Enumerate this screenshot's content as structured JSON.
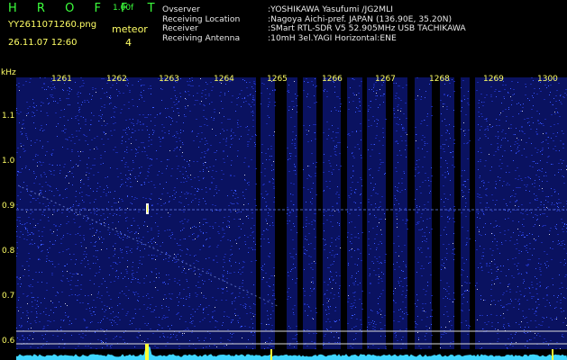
{
  "header": {
    "app_name": "H R O F F T",
    "version": "1.00f",
    "filename": "YY2611071260.png",
    "timestamp": "26.11.07 12:60",
    "meteor_label": "meteor",
    "meteor_count": "4",
    "info": [
      {
        "key": "Ovserver",
        "value": ":YOSHIKAWA Yasufumi /JG2MLI"
      },
      {
        "key": "Receiving Location",
        "value": ":Nagoya Aichi-pref. JAPAN (136.90E, 35.20N)"
      },
      {
        "key": "Receiver",
        "value": ":SMart RTL-SDR V5 52.905MHz USB TACHIKAWA"
      },
      {
        "key": "Receiving Antenna",
        "value": ":10mH 3el.YAGI Horizontal:ENE"
      }
    ]
  },
  "spectrogram": {
    "unit": "kHz",
    "y_ticks": [
      "1.1",
      "1.0",
      "0.9",
      "0.8",
      "0.7",
      "0.6"
    ],
    "x_ticks": [
      "1261",
      "1262",
      "1263",
      "1264",
      "1265",
      "1266",
      "1267",
      "1268",
      "1269",
      "1300"
    ],
    "colors": {
      "background": "#000000",
      "noise": "#1a2aa8",
      "noise_bright": "#3a5aff",
      "signal": "#ffffff",
      "meteor": "#ffff33",
      "label": "#ffff66",
      "level": "#3fd6ff"
    }
  }
}
